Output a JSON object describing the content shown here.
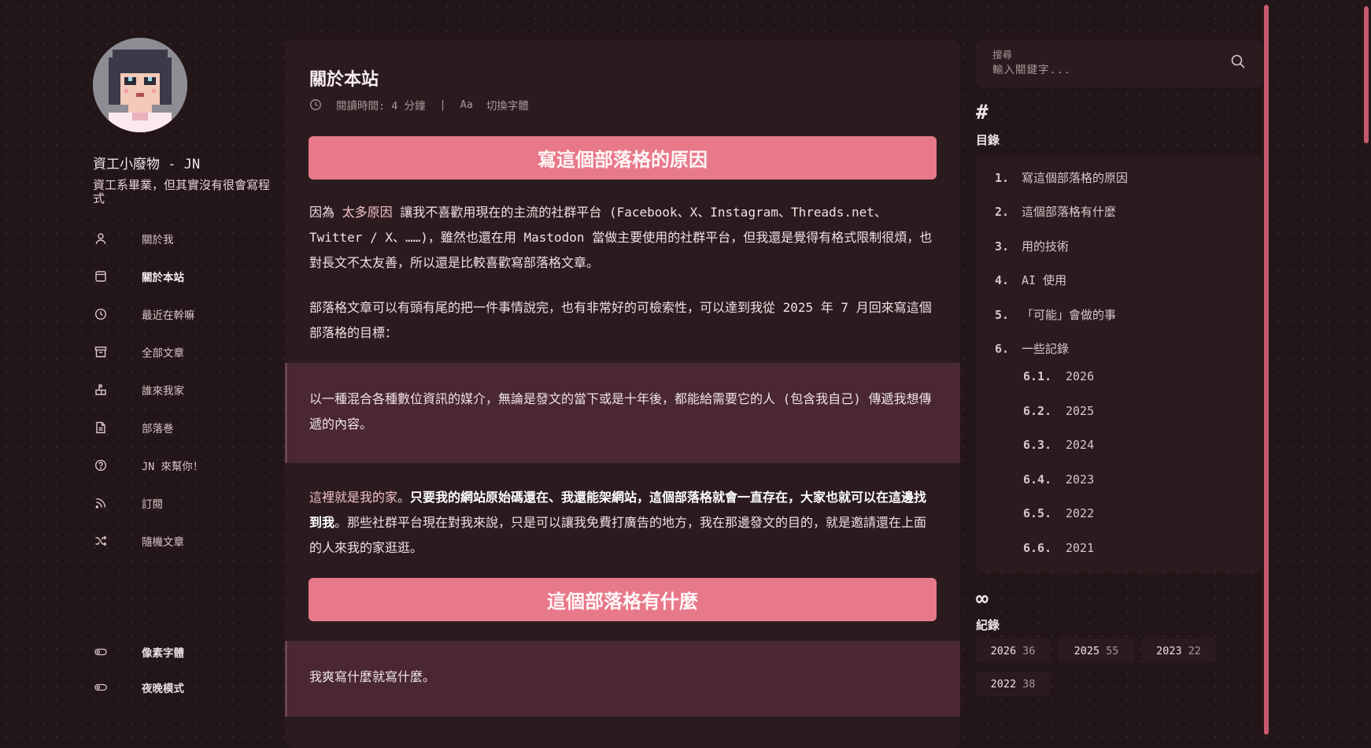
{
  "site": {
    "title": "資工小廢物 - JN",
    "subtitle": "資工系畢業，但其實沒有很會寫程式"
  },
  "nav": [
    {
      "label": "關於我",
      "icon": "user-icon",
      "active": false
    },
    {
      "label": "關於本站",
      "icon": "browser-window-icon",
      "active": true
    },
    {
      "label": "最近在幹嘛",
      "icon": "clock-icon",
      "active": false
    },
    {
      "label": "全部文章",
      "icon": "archive-box-icon",
      "active": false
    },
    {
      "label": "誰來我家",
      "icon": "mailbox-icon",
      "active": false
    },
    {
      "label": "部落巻",
      "icon": "document-icon",
      "active": false
    },
    {
      "label": "JN 來幫你！",
      "icon": "help-circle-icon",
      "active": false
    },
    {
      "label": "訂閱",
      "icon": "rss-icon",
      "active": false
    },
    {
      "label": "隨機文章",
      "icon": "shuffle-icon",
      "active": false
    }
  ],
  "toggles": [
    {
      "label": "像素字體",
      "icon": "toggle-icon"
    },
    {
      "label": "夜晚模式",
      "icon": "toggle-icon"
    }
  ],
  "article": {
    "title": "關於本站",
    "reading_time": "閱讀時間: 4 分鐘",
    "font_switch": "切換字體",
    "font_switch_icon_text": "Aa",
    "sections": [
      {
        "heading": "寫這個部落格的原因"
      },
      {
        "heading": "這個部落格有什麼"
      }
    ],
    "p1_link": "太多原因",
    "p1_rest": "讓我不喜歡用現在的主流的社群平台 (Facebook、X、Instagram、Threads.net、Twitter / X、……)，雖然也還在用 Mastodon 當做主要使用的社群平台，但我還是覺得有格式限制很煩，也對長文不太友善，所以還是比較喜歡寫部落格文章。",
    "p1_prefix": "因為",
    "p2": "部落格文章可以有頭有尾的把一件事情說完，也有非常好的可檢索性，可以達到我從 2025 年 7 月回來寫這個部落格的目標：",
    "quote1": "以一種混合各種數位資訊的媒介，無論是發文的當下或是十年後，都能給需要它的人 (包含我自己) 傳遞我想傳遞的內容。",
    "p3_link": "這裡就是我的家",
    "p3_bold": "只要我的網站原始碼還在、我還能架網站，這個部落格就會一直存在，大家也就可以在這邊找到我",
    "p3_rest": "。那些社群平台現在對我來說，只是可以讓我免費打廣告的地方，我在那邊發文的目的，就是邀請還在上面的人來我的家逛逛。",
    "quote2": "我爽寫什麼就寫什麼。"
  },
  "search": {
    "label": "搜尋",
    "placeholder": "輸入關鍵字..."
  },
  "toc": {
    "icon": "#",
    "title": "目錄",
    "items": [
      {
        "num": "1.",
        "label": "寫這個部落格的原因"
      },
      {
        "num": "2.",
        "label": "這個部落格有什麼"
      },
      {
        "num": "3.",
        "label": "用的技術"
      },
      {
        "num": "4.",
        "label": "AI 使用"
      },
      {
        "num": "5.",
        "label": "「可能」會做的事"
      },
      {
        "num": "6.",
        "label": "一些記錄"
      },
      {
        "num": "6.1.",
        "label": "2026"
      },
      {
        "num": "6.2.",
        "label": "2025"
      },
      {
        "num": "6.3.",
        "label": "2024"
      },
      {
        "num": "6.4.",
        "label": "2023"
      },
      {
        "num": "6.5.",
        "label": "2022"
      },
      {
        "num": "6.6.",
        "label": "2021"
      }
    ]
  },
  "archives": {
    "icon": "∞",
    "title": "紀錄",
    "items": [
      {
        "year": "2026",
        "count": "36"
      },
      {
        "year": "2025",
        "count": "55"
      },
      {
        "year": "2023",
        "count": "22"
      },
      {
        "year": "2022",
        "count": "38"
      }
    ]
  },
  "colors": {
    "background": "#231618",
    "card": "#2c1b1e",
    "accent": "#e8798a",
    "quote_bg": "#4a2733",
    "scrollbar": "#c65a6f"
  }
}
